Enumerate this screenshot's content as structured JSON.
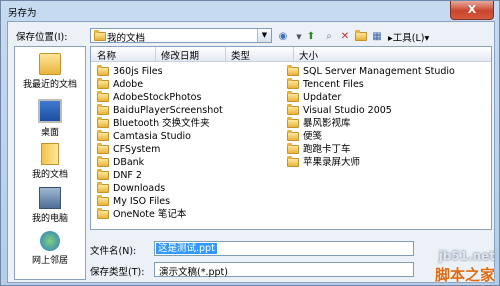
{
  "window": {
    "title": "另存为",
    "close_glyph": "X"
  },
  "location_bar": {
    "label": "保存位置(I):",
    "value": "我的文档"
  },
  "toolbar": {
    "tools_label": "工具(L)"
  },
  "places": [
    {
      "label": "我最近的文档",
      "icon": "recent-documents-icon"
    },
    {
      "label": "桌面",
      "icon": "desktop-icon"
    },
    {
      "label": "我的文档",
      "icon": "my-documents-icon"
    },
    {
      "label": "我的电脑",
      "icon": "my-computer-icon"
    },
    {
      "label": "网上邻居",
      "icon": "network-icon"
    }
  ],
  "columns": {
    "name": "名称",
    "modified": "修改日期",
    "type": "类型",
    "size": "大小"
  },
  "files_left": [
    "360js Files",
    "Adobe",
    "AdobeStockPhotos",
    "BaiduPlayerScreenshot",
    "Bluetooth 交换文件夹",
    "Camtasia Studio",
    "CFSystem",
    "DBank",
    "DNF 2",
    "Downloads",
    "My ISO Files",
    "OneNote 笔记本"
  ],
  "files_right": [
    "SQL Server Management Studio",
    "Tencent Files",
    "Updater",
    "Visual Studio 2005",
    "暴风影视库",
    "便笺",
    "跑跑卡丁车",
    "苹果录屏大师"
  ],
  "filename": {
    "label": "文件名(N):",
    "value": "这是测试.ppt"
  },
  "filetype": {
    "label": "保存类型(T):",
    "value": "演示文稿(*.ppt)"
  },
  "watermark": {
    "line1": "jb51.net",
    "line2": "脚本之家"
  }
}
